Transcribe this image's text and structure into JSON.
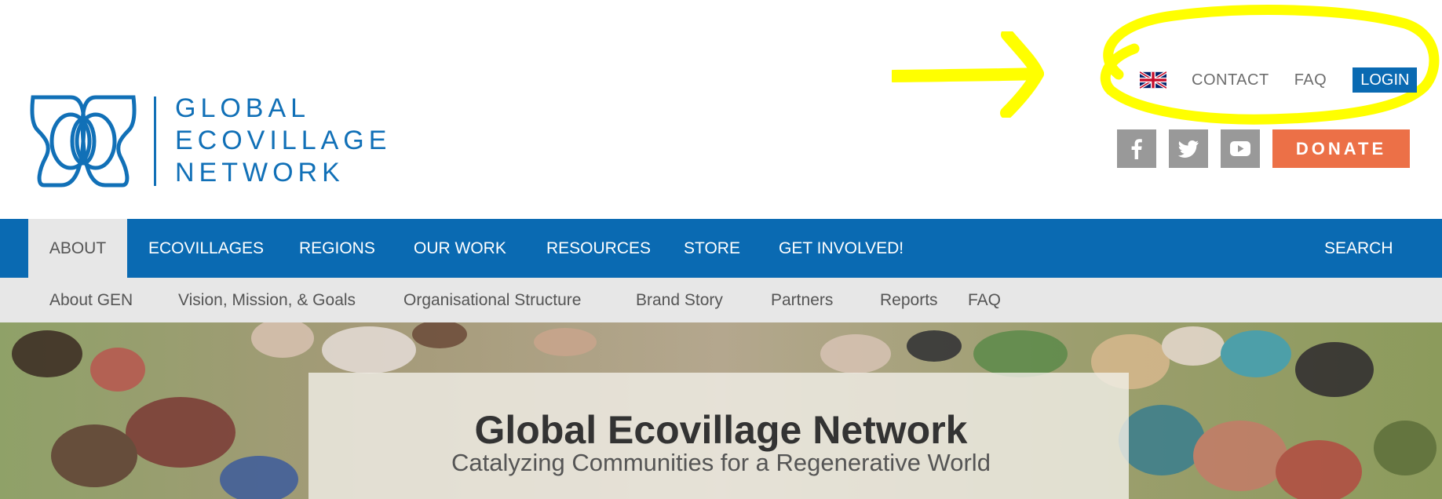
{
  "logo": {
    "line1": "GLOBAL",
    "line2": "ECOVILLAGE",
    "line3": "NETWORK",
    "icon": "butterfly-knot-logo",
    "color": "#1170b7"
  },
  "topnav": {
    "language_icon": "uk-flag-icon",
    "contact": "CONTACT",
    "faq": "FAQ",
    "login": "LOGIN"
  },
  "social": {
    "facebook": "facebook-icon",
    "twitter": "twitter-icon",
    "youtube": "youtube-icon"
  },
  "donate": "DONATE",
  "mainnav": {
    "items": [
      "ABOUT",
      "ECOVILLAGES",
      "REGIONS",
      "OUR WORK",
      "RESOURCES",
      "STORE",
      "GET INVOLVED!"
    ],
    "active": "ABOUT",
    "search": "SEARCH"
  },
  "subnav": {
    "items": [
      "About GEN",
      "Vision, Mission, & Goals",
      "Organisational Structure",
      "Brand Story",
      "Partners",
      "Reports",
      "FAQ"
    ]
  },
  "hero": {
    "title": "Global Ecovillage Network",
    "subtitle": "Catalyzing Communities for a Regenerative World"
  },
  "colors": {
    "brand_blue": "#0a6ab2",
    "donate_orange": "#ec7047",
    "social_gray": "#999999",
    "annotation_yellow": "#ffff00"
  }
}
